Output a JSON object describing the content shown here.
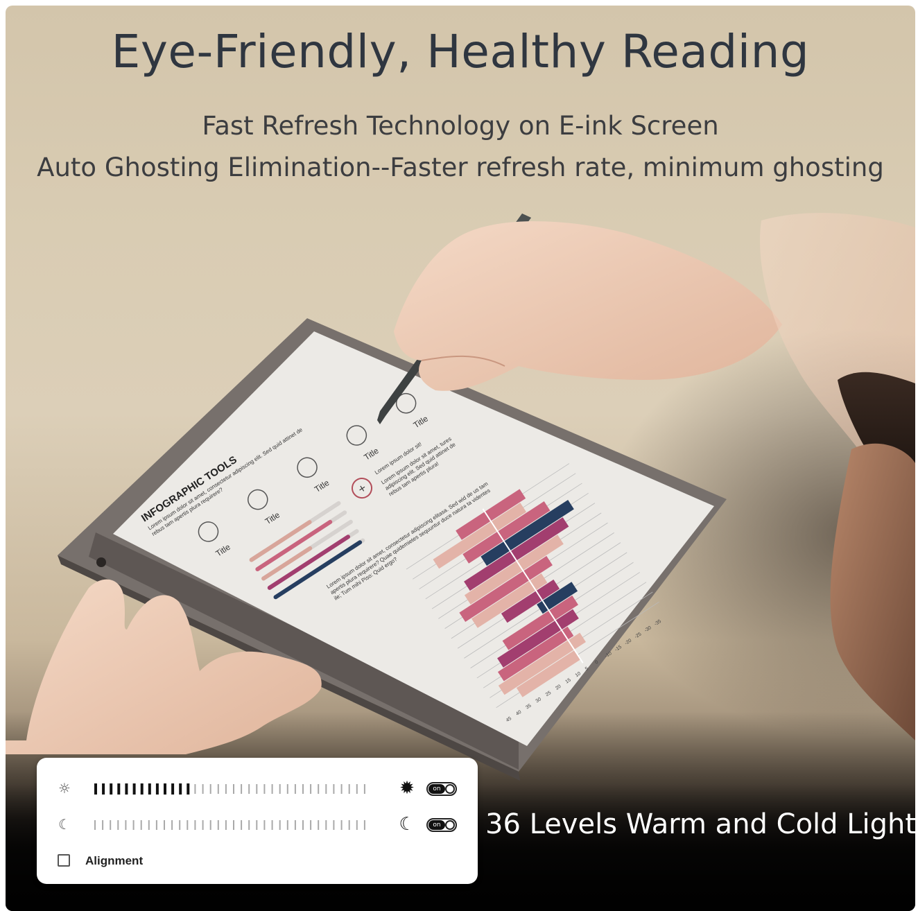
{
  "header": {
    "title": "Eye-Friendly, Healthy Reading",
    "subtitle_line1": "Fast Refresh Technology on E-ink Screen",
    "subtitle_line2": "Auto Ghosting Elimination--Faster refresh rate, minimum ghosting"
  },
  "tablet_screen": {
    "heading": "INFOGRAPHIC TOOLS",
    "intro": "Lorem ipsum dolor sit amet, consectetur adipiscing elit. Sed quid attinet de rebus tam apertis plura requirere?",
    "icon_titles": [
      "Title",
      "Title",
      "Title",
      "Title",
      "Title"
    ],
    "note_a": "Lorem ipsum dolor sit!",
    "note_b": "Lorem ipsum dolor sit amet, tures adipiscing elit. Sed quid attinet de rebus tam apertis plura!",
    "body_text": "Lorem ipsum dolor sit amet, consectetur adipiscing elitasa. Sed wid de us tam apertis plura requirere? Quae quidemietes sequuntur duce natura ta videntes ile; Tum mihi Piso: Quid ergo?",
    "axis_ticks": [
      "45",
      "40",
      "35",
      "30",
      "25",
      "20",
      "15",
      "10",
      "5",
      "0",
      "-10",
      "-15",
      "-20",
      "-25",
      "-30",
      "-35"
    ],
    "icons": [
      "chat-icon",
      "heart-icon",
      "menu-icon",
      "chevron-icon",
      "chat-icon",
      "plus-icon"
    ]
  },
  "light_panel": {
    "warm_on_label": "on",
    "cold_on_label": "on",
    "alignment_label": "Alignment",
    "warm_level_fraction": 0.36,
    "cold_level_fraction": 0.0,
    "total_levels": 36,
    "icons": {
      "warm_left": "sun-small-icon",
      "warm_right": "sun-large-icon",
      "cold_left": "moon-small-icon",
      "cold_right": "moon-large-icon"
    }
  },
  "caption": "36 Levels Warm and Cold Light",
  "colors": {
    "bar_pink": "#c9647e",
    "bar_light_pink": "#e3b3a8",
    "bar_magenta": "#a23e6f",
    "bar_navy": "#263e60",
    "headline": "#2f3640"
  }
}
